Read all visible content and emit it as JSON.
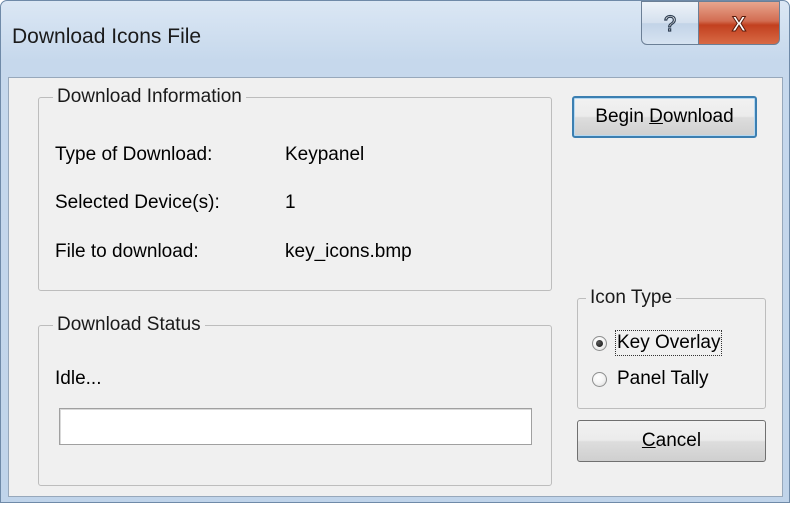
{
  "window": {
    "title": "Download Icons File",
    "help_glyph": "?",
    "close_glyph": "X"
  },
  "download_info": {
    "legend": "Download Information",
    "rows": [
      {
        "label": "Type of Download:",
        "value": "Keypanel"
      },
      {
        "label": "Selected Device(s):",
        "value": "1"
      },
      {
        "label": "File to download:",
        "value": "key_icons.bmp"
      }
    ]
  },
  "download_status": {
    "legend": "Download Status",
    "text": "Idle...",
    "progress": 0
  },
  "buttons": {
    "begin_prefix": "Begin ",
    "begin_accel": "D",
    "begin_rest": "ownload",
    "cancel_accel": "C",
    "cancel_rest": "ancel"
  },
  "icon_type": {
    "legend": "Icon Type",
    "options": [
      {
        "label": "Key Overlay",
        "checked": true
      },
      {
        "label": "Panel Tally",
        "checked": false
      }
    ]
  }
}
